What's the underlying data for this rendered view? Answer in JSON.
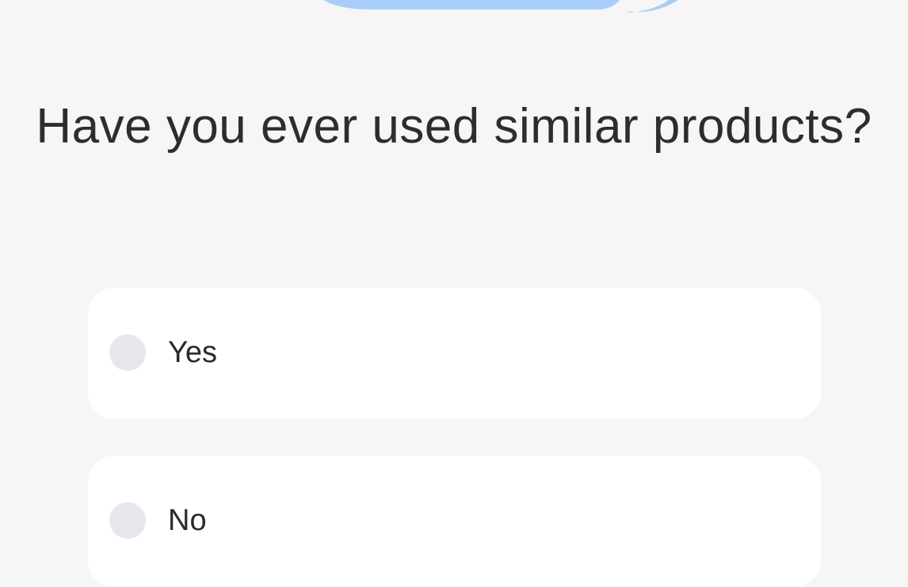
{
  "survey": {
    "question": "Have you ever used similar products?",
    "options": [
      {
        "label": "Yes",
        "selected": false
      },
      {
        "label": "No",
        "selected": false
      }
    ]
  },
  "colors": {
    "background": "#f6f6f7",
    "card": "#ffffff",
    "radio": "#e6e7ec",
    "illustration": "#a8cef8",
    "text": "#2d2d30"
  },
  "icons": {
    "illustration": "speech-bubble-illustration",
    "radio": "radio-circle"
  }
}
